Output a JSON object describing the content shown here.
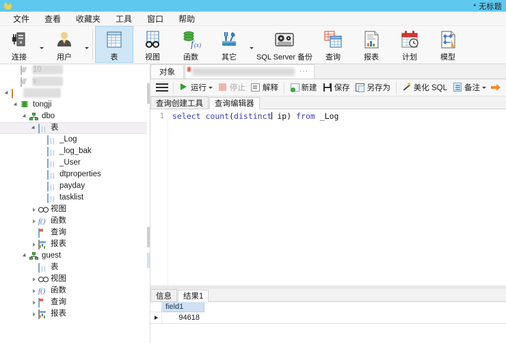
{
  "window": {
    "title": "* 无标题",
    "logo_icon": "app-logo-icon"
  },
  "menubar": {
    "items": [
      {
        "label": "文件"
      },
      {
        "label": "查看"
      },
      {
        "label": "收藏夹"
      },
      {
        "label": "工具"
      },
      {
        "label": "窗口"
      },
      {
        "label": "帮助"
      }
    ]
  },
  "ribbon": {
    "buttons": [
      {
        "label": "连接",
        "icon": "server-plug-icon",
        "has_caret": true,
        "active": false
      },
      {
        "label": "用户",
        "icon": "user-icon",
        "has_caret": true,
        "active": false
      },
      {
        "label": "表",
        "icon": "table-icon",
        "has_caret": false,
        "active": true
      },
      {
        "label": "视图",
        "icon": "view-glasses-icon",
        "has_caret": false,
        "active": false
      },
      {
        "label": "函数",
        "icon": "function-fx-icon",
        "has_caret": false,
        "active": false
      },
      {
        "label": "其它",
        "icon": "tools-wrench-icon",
        "has_caret": true,
        "active": false
      },
      {
        "label": "SQL Server 备份",
        "icon": "backup-tape-icon",
        "has_caret": false,
        "active": false
      },
      {
        "label": "查询",
        "icon": "query-icon",
        "has_caret": false,
        "active": false
      },
      {
        "label": "报表",
        "icon": "report-icon",
        "has_caret": false,
        "active": false
      },
      {
        "label": "计划",
        "icon": "schedule-calendar-icon",
        "has_caret": false,
        "active": false
      },
      {
        "label": "模型",
        "icon": "model-diagram-icon",
        "has_caret": false,
        "active": false
      }
    ]
  },
  "tree": {
    "nodes": [
      {
        "label": "10",
        "icon": "connection-icon",
        "indent": 1,
        "state": "none",
        "redacted": true
      },
      {
        "label": "v",
        "icon": "connection-icon",
        "indent": 1,
        "state": "none",
        "redacted": true
      },
      {
        "label": "",
        "icon": "folder-icon",
        "indent": 0,
        "state": "expanded",
        "redacted": true
      },
      {
        "label": "tongji",
        "icon": "database-icon",
        "indent": 1,
        "state": "expanded",
        "redacted": false
      },
      {
        "label": "dbo",
        "icon": "schema-icon",
        "indent": 2,
        "state": "expanded",
        "redacted": false
      },
      {
        "label": "表",
        "icon": "table-icon",
        "indent": 3,
        "state": "expanded",
        "selected": true,
        "redacted": false
      },
      {
        "label": "_Log",
        "icon": "table-icon",
        "indent": 4,
        "state": "none",
        "redacted": false
      },
      {
        "label": "_log_bak",
        "icon": "table-icon",
        "indent": 4,
        "state": "none",
        "redacted": false
      },
      {
        "label": "_User",
        "icon": "table-icon",
        "indent": 4,
        "state": "none",
        "redacted": false
      },
      {
        "label": "dtproperties",
        "icon": "table-icon",
        "indent": 4,
        "state": "none",
        "redacted": false
      },
      {
        "label": "payday",
        "icon": "table-icon",
        "indent": 4,
        "state": "none",
        "redacted": false
      },
      {
        "label": "tasklist",
        "icon": "table-icon",
        "indent": 4,
        "state": "none",
        "redacted": false
      },
      {
        "label": "视图",
        "icon": "view-glasses-icon",
        "indent": 3,
        "state": "collapsed",
        "redacted": false
      },
      {
        "label": "函数",
        "icon": "function-fx-icon",
        "indent": 3,
        "state": "collapsed",
        "redacted": false
      },
      {
        "label": "查询",
        "icon": "query-icon",
        "indent": 3,
        "state": "none",
        "redacted": false
      },
      {
        "label": "报表",
        "icon": "report-icon",
        "indent": 3,
        "state": "collapsed",
        "redacted": false
      },
      {
        "label": "guest",
        "icon": "schema-icon",
        "indent": 2,
        "state": "expanded",
        "redacted": false
      },
      {
        "label": "表",
        "icon": "table-icon",
        "indent": 3,
        "state": "none",
        "redacted": false
      },
      {
        "label": "视图",
        "icon": "view-glasses-icon",
        "indent": 3,
        "state": "collapsed",
        "redacted": false
      },
      {
        "label": "函数",
        "icon": "function-fx-icon",
        "indent": 3,
        "state": "collapsed",
        "redacted": false
      },
      {
        "label": "查询",
        "icon": "query-icon",
        "indent": 3,
        "state": "collapsed",
        "redacted": false
      },
      {
        "label": "报表",
        "icon": "report-icon",
        "indent": 3,
        "state": "collapsed",
        "redacted": false
      }
    ]
  },
  "doctabs": {
    "tabs": [
      {
        "label": "对象",
        "active": false,
        "blurred": false
      },
      {
        "label": "",
        "active": true,
        "blurred": true,
        "overflow": "···"
      }
    ]
  },
  "query_toolbar": {
    "menu_icon": "hamburger-menu-icon",
    "buttons": [
      {
        "label": "运行",
        "icon": "run-play-icon",
        "caret": true,
        "disabled": false
      },
      {
        "label": "停止",
        "icon": "stop-icon",
        "caret": false,
        "disabled": true
      },
      {
        "label": "解释",
        "icon": "explain-icon",
        "caret": false,
        "disabled": false
      },
      {
        "label": "新建",
        "icon": "new-query-icon",
        "caret": false,
        "disabled": false
      },
      {
        "label": "保存",
        "icon": "save-icon",
        "caret": false,
        "disabled": false
      },
      {
        "label": "另存为",
        "icon": "save-as-icon",
        "caret": false,
        "disabled": false
      },
      {
        "label": "美化 SQL",
        "icon": "beautify-sql-icon",
        "caret": false,
        "disabled": false
      },
      {
        "label": "备注",
        "icon": "comment-icon",
        "caret": true,
        "disabled": false
      }
    ],
    "overflow_icon": "orange-arrow-icon"
  },
  "inner_tabs": {
    "tabs": [
      {
        "label": "查询创建工具",
        "active": false
      },
      {
        "label": "查询编辑器",
        "active": true
      }
    ]
  },
  "editor": {
    "line_number": "1",
    "code_tokens": [
      {
        "text": "select",
        "type": "keyword"
      },
      {
        "text": " ",
        "type": "plain"
      },
      {
        "text": "count",
        "type": "keyword"
      },
      {
        "text": "(",
        "type": "plain"
      },
      {
        "text": "distinct",
        "type": "keyword"
      },
      {
        "text": "|CARET|",
        "type": "caret"
      },
      {
        "text": " ip",
        "type": "plain"
      },
      {
        "text": ")",
        "type": "plain"
      },
      {
        "text": " ",
        "type": "plain"
      },
      {
        "text": "from",
        "type": "keyword"
      },
      {
        "text": " ",
        "type": "plain"
      },
      {
        "text": "_Log",
        "type": "plain"
      }
    ],
    "code_plain": "select count(distinct ip) from _Log"
  },
  "result_tabs": {
    "tabs": [
      {
        "label": "信息",
        "active": false
      },
      {
        "label": "结果1",
        "active": true
      }
    ]
  },
  "result_grid": {
    "columns": [
      "field1"
    ],
    "rows": [
      {
        "selected": true,
        "values": [
          "94618"
        ]
      }
    ]
  },
  "colors": {
    "titlebar": "#5ec8ef",
    "ribbon_active": "#cfe6f7",
    "grid_header": "#cfe1f2",
    "keyword": "#3b3bcc",
    "run_green": "#2aa12a"
  }
}
